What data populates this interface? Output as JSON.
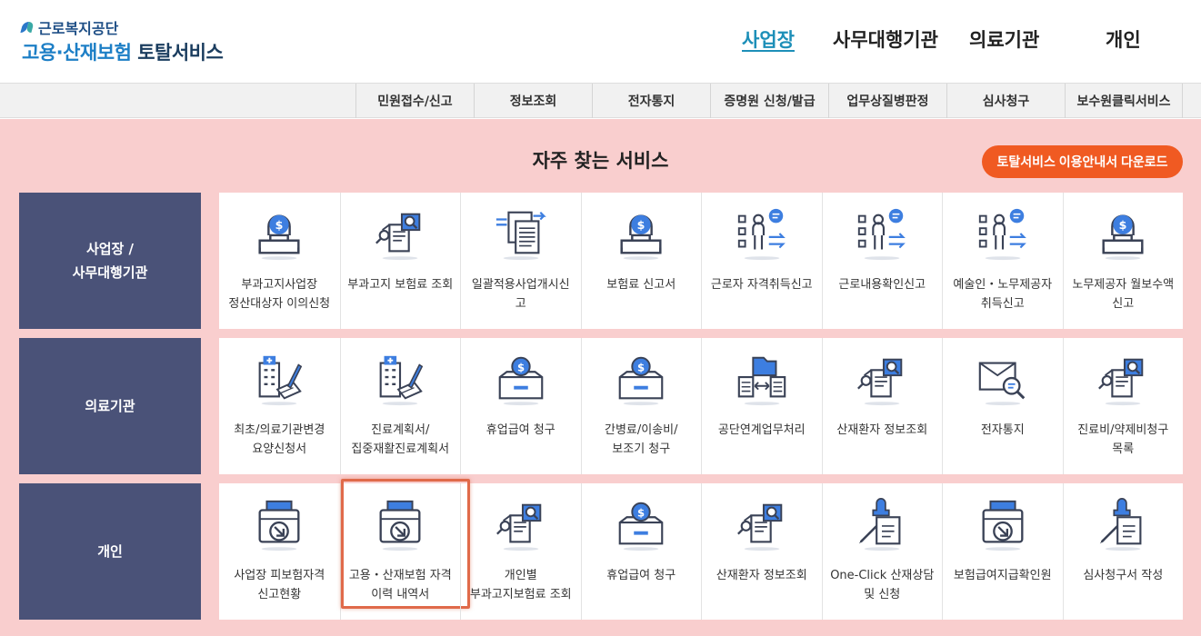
{
  "logo": {
    "org": "근로복지공단",
    "title_part1": "고용·산재보험",
    "title_part2": "토탈서비스"
  },
  "top_nav": [
    "사업장",
    "사무대행기관",
    "의료기관",
    "개인"
  ],
  "menu": [
    "민원접수/신고",
    "정보조회",
    "전자통지",
    "증명원 신청/발급",
    "업무상질병판정",
    "심사청구",
    "보수원클릭서비스"
  ],
  "section": {
    "title": "자주 찾는 서비스",
    "download_label": "토탈서비스 이용안내서 다운로드"
  },
  "rows": [
    {
      "label_lines": [
        "사업장 /",
        "사무대행기관"
      ],
      "cards": [
        {
          "label": "부과고지사업장 정산대상자 이의신청",
          "icon": "money-monitor-icon"
        },
        {
          "label": "부과고지 보험료 조회",
          "icon": "document-search-icon"
        },
        {
          "label": "일괄적용사업개시신고",
          "icon": "document-transfer-icon"
        },
        {
          "label": "보험료 신고서",
          "icon": "money-monitor-icon"
        },
        {
          "label": "근로자 자격취득신고",
          "icon": "person-list-icon"
        },
        {
          "label": "근로내용확인신고",
          "icon": "person-list-icon"
        },
        {
          "label": "예술인・노무제공자 취득신고",
          "icon": "person-list-icon"
        },
        {
          "label": "노무제공자 월보수액 신고",
          "icon": "money-monitor-icon"
        }
      ]
    },
    {
      "label_lines": [
        "의료기관"
      ],
      "cards": [
        {
          "label": "최초/의료기관변경 요양신청서",
          "icon": "hospital-document-icon"
        },
        {
          "label": "진료계획서/집중재활진료계획서",
          "icon": "hospital-document-icon"
        },
        {
          "label": "휴업급여 청구",
          "icon": "coin-box-icon"
        },
        {
          "label": "간병료/이송비/보조기 청구",
          "icon": "coin-box-icon"
        },
        {
          "label": "공단연계업무처리",
          "icon": "folder-exchange-icon"
        },
        {
          "label": "산재환자 정보조회",
          "icon": "document-search-icon"
        },
        {
          "label": "전자통지",
          "icon": "box-search-icon"
        },
        {
          "label": "진료비/약제비청구 목록",
          "icon": "document-search-icon"
        }
      ]
    },
    {
      "label_lines": [
        "개인"
      ],
      "cards": [
        {
          "label": "사업장 피보험자격 신고현황",
          "icon": "printer-arrow-icon"
        },
        {
          "label": "고용・산재보험 자격 이력 내역서",
          "icon": "printer-arrow-icon",
          "highlight": true
        },
        {
          "label": "개인별 부과고지보험료 조회",
          "icon": "document-search-icon"
        },
        {
          "label": "휴업급여 청구",
          "icon": "coin-box-icon"
        },
        {
          "label": "산재환자 정보조회",
          "icon": "document-search-icon"
        },
        {
          "label": "One-Click 산재상담 및 신청",
          "icon": "stamp-document-icon"
        },
        {
          "label": "보험급여지급확인원",
          "icon": "printer-arrow-icon"
        },
        {
          "label": "심사청구서 작성",
          "icon": "stamp-document-icon"
        }
      ]
    }
  ],
  "colors": {
    "accent": "#1d8fb8",
    "row_label_bg": "#4a5278",
    "main_bg": "#f9cece",
    "button": "#f05a22",
    "icon_dark": "#3a4256",
    "icon_blue": "#3d7ee0",
    "highlight_border": "#e06a4a"
  }
}
